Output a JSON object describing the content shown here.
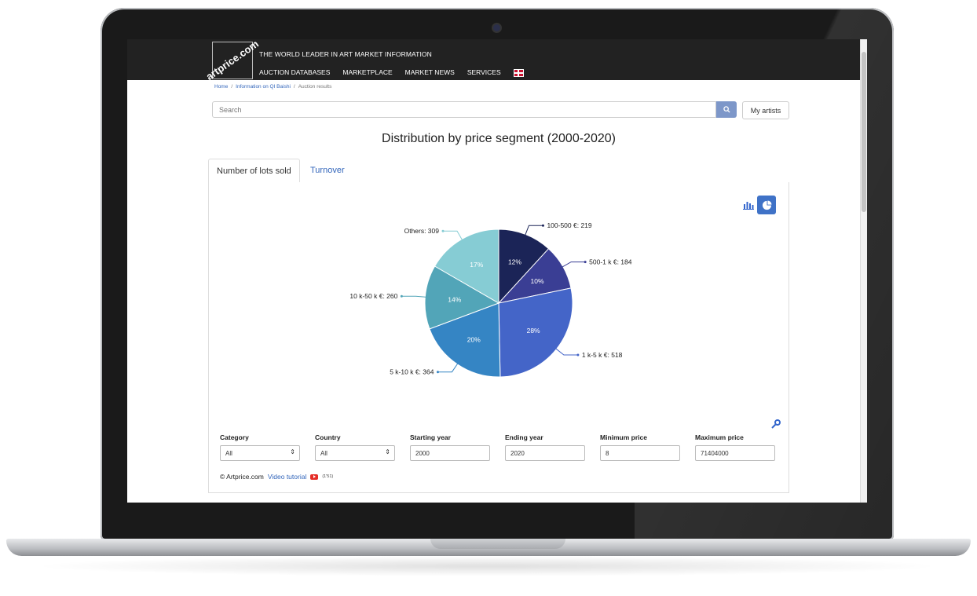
{
  "header": {
    "logo_text": "artprice.com",
    "tagline": "THE WORLD LEADER IN ART MARKET INFORMATION",
    "nav": [
      "AUCTION DATABASES",
      "MARKETPLACE",
      "MARKET NEWS",
      "SERVICES"
    ]
  },
  "breadcrumb": {
    "home": "Home",
    "artist": "Information on QI Baishi",
    "current": "Auction results",
    "separator": "/"
  },
  "search": {
    "placeholder": "Search",
    "my_artists": "My artists"
  },
  "page_title": "Distribution by price segment (2000-2020)",
  "tabs": [
    {
      "label": "Number of lots sold",
      "active": true
    },
    {
      "label": "Turnover",
      "active": false
    }
  ],
  "chart_data": {
    "type": "pie",
    "slices": [
      {
        "label": "100-500 €: 219",
        "value": 219,
        "percent": "12%",
        "color": "#1b2457"
      },
      {
        "label": "500-1 k €: 184",
        "value": 184,
        "percent": "10%",
        "color": "#3a3e94"
      },
      {
        "label": "1 k-5 k €: 518",
        "value": 518,
        "percent": "28%",
        "color": "#4465c8"
      },
      {
        "label": "5 k-10 k €: 364",
        "value": 364,
        "percent": "20%",
        "color": "#3585c4"
      },
      {
        "label": "10 k-50 k €: 260",
        "value": 260,
        "percent": "14%",
        "color": "#52a5b8"
      },
      {
        "label": "Others: 309",
        "value": 309,
        "percent": "17%",
        "color": "#86ccd4"
      }
    ]
  },
  "filters": [
    {
      "label": "Category",
      "value": "All",
      "type": "select"
    },
    {
      "label": "Country",
      "value": "All",
      "type": "select"
    },
    {
      "label": "Starting year",
      "value": "2000",
      "type": "input"
    },
    {
      "label": "Ending year",
      "value": "2020",
      "type": "input"
    },
    {
      "label": "Minimum price",
      "value": "8",
      "type": "input"
    },
    {
      "label": "Maximum price",
      "value": "71404000",
      "type": "input"
    }
  ],
  "footer": {
    "copyright": "© Artprice.com",
    "video_link": "Video tutorial",
    "duration": "(1'51)"
  },
  "colors": {
    "accent": "#3f72c7",
    "topbar": "#222222"
  }
}
